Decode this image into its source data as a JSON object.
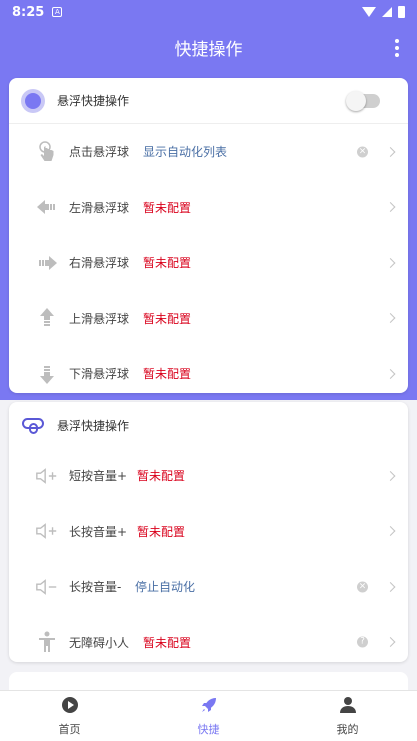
{
  "status": {
    "time": "8:25"
  },
  "appbar": {
    "title": "快捷操作"
  },
  "colors": {
    "accent": "#7a78f2",
    "link": "#4a6fa5",
    "warn": "#d9001b"
  },
  "card1": {
    "header": "悬浮快捷操作",
    "toggle_on": false,
    "rows": [
      {
        "icon": "tap-icon",
        "label": "点击悬浮球",
        "value": "显示自动化列表",
        "style": "blue",
        "clearable": true
      },
      {
        "icon": "swipe-left-icon",
        "label": "左滑悬浮球",
        "value": "暂未配置",
        "style": "red",
        "clearable": false
      },
      {
        "icon": "swipe-right-icon",
        "label": "右滑悬浮球",
        "value": "暂未配置",
        "style": "red",
        "clearable": false
      },
      {
        "icon": "swipe-up-icon",
        "label": "上滑悬浮球",
        "value": "暂未配置",
        "style": "red",
        "clearable": false
      },
      {
        "icon": "swipe-down-icon",
        "label": "下滑悬浮球",
        "value": "暂未配置",
        "style": "red",
        "clearable": false
      }
    ]
  },
  "card2": {
    "header": "悬浮快捷操作",
    "rows": [
      {
        "icon": "volume-up-icon",
        "label": "短按音量+",
        "value": "暂未配置",
        "style": "red",
        "clearable": false
      },
      {
        "icon": "volume-up-icon",
        "label": "长按音量+",
        "value": "暂未配置",
        "style": "red",
        "clearable": false
      },
      {
        "icon": "volume-down-icon",
        "label": "长按音量-",
        "value": "停止自动化",
        "style": "blue",
        "clearable": true
      },
      {
        "icon": "accessibility-icon",
        "label": "无障碍小人",
        "value": "暂未配置",
        "style": "red",
        "help": true
      }
    ]
  },
  "nav": [
    {
      "icon": "play-icon",
      "label": "首页",
      "active": false
    },
    {
      "icon": "rocket-icon",
      "label": "快捷",
      "active": true
    },
    {
      "icon": "person-icon",
      "label": "我的",
      "active": false
    }
  ]
}
